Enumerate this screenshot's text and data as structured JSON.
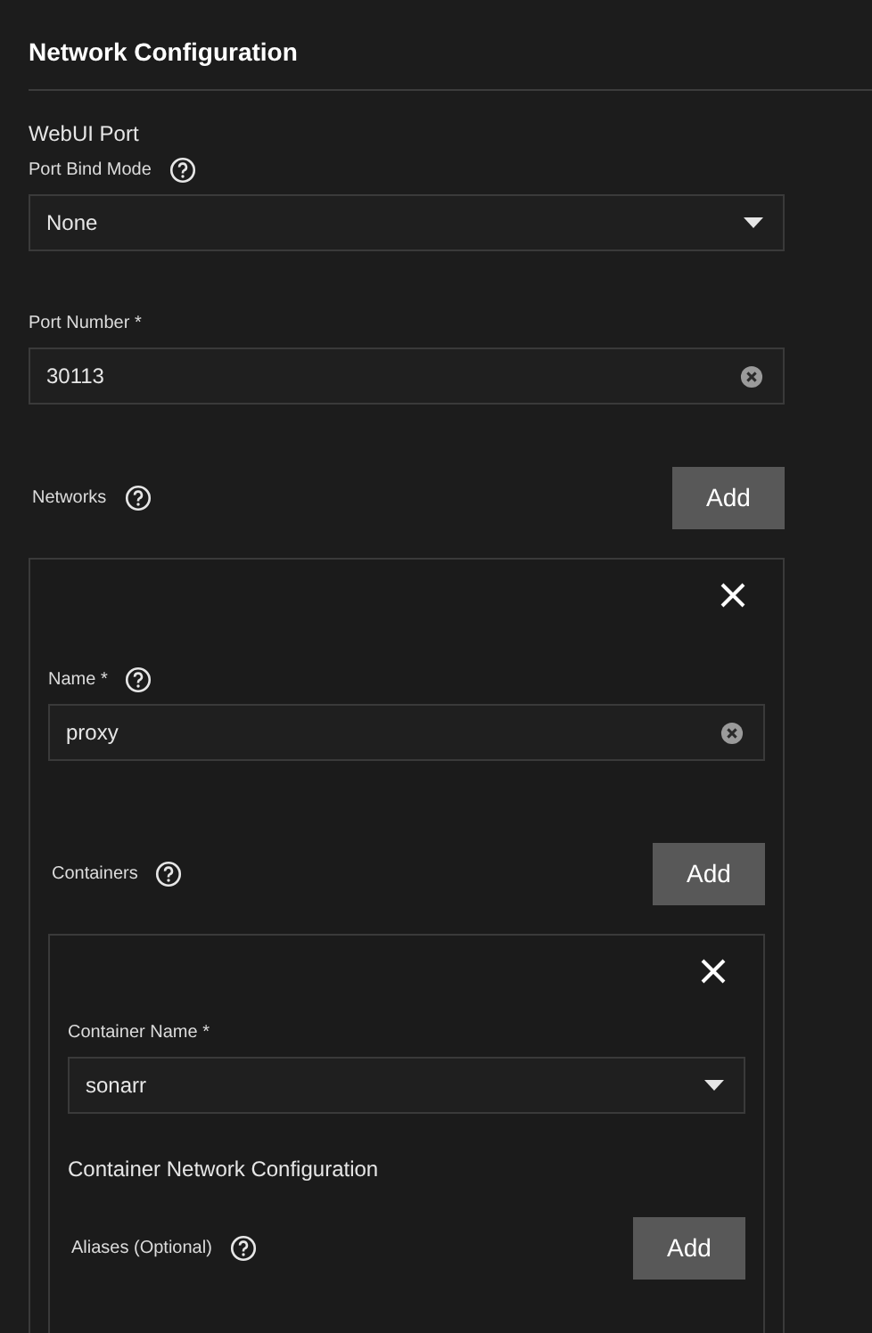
{
  "section_title": "Network Configuration",
  "webui_port": {
    "heading": "WebUI Port",
    "port_bind_mode": {
      "label": "Port Bind Mode",
      "value": "None"
    },
    "port_number": {
      "label": "Port Number *",
      "value": "30113"
    }
  },
  "networks": {
    "label": "Networks",
    "add_button": "Add",
    "items": [
      {
        "name_field": {
          "label": "Name *",
          "value": "proxy"
        },
        "containers": {
          "label": "Containers",
          "add_button": "Add",
          "items": [
            {
              "container_name": {
                "label": "Container Name *",
                "value": "sonarr"
              },
              "network_config_heading": "Container Network Configuration",
              "aliases": {
                "label": "Aliases (Optional)",
                "add_button": "Add"
              }
            }
          ]
        }
      }
    ]
  }
}
